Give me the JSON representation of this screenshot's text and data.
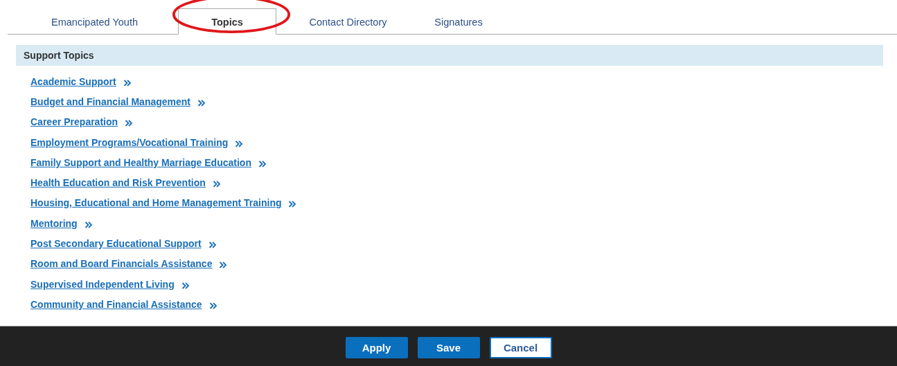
{
  "tabs": [
    {
      "label": "Emancipated Youth",
      "selected": false,
      "highlighted": false
    },
    {
      "label": "Topics",
      "selected": true,
      "highlighted": true
    },
    {
      "label": "Contact Directory",
      "selected": false,
      "highlighted": false
    },
    {
      "label": "Signatures",
      "selected": false,
      "highlighted": false
    }
  ],
  "panel": {
    "title": "Support Topics",
    "links": [
      "Academic Support",
      "Budget and Financial Management",
      "Career Preparation",
      "Employment Programs/Vocational Training",
      "Family Support and Healthy Marriage Education",
      "Health Education and Risk Prevention",
      "Housing, Educational and Home Management Training",
      "Mentoring",
      "Post Secondary Educational Support",
      "Room and Board Financials Assistance",
      "Supervised Independent Living",
      "Community and Financial Assistance"
    ]
  },
  "buttons": [
    {
      "label": "Apply",
      "kind": "primary"
    },
    {
      "label": "Save",
      "kind": "primary"
    },
    {
      "label": "Cancel",
      "kind": "secondary"
    }
  ]
}
